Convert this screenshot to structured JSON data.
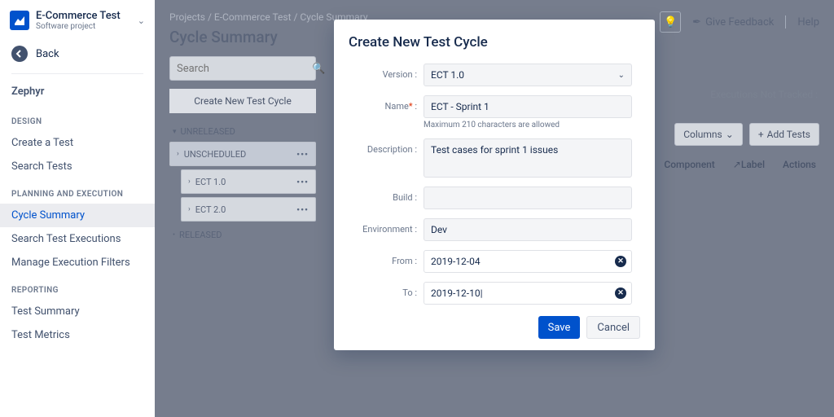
{
  "sidebar": {
    "project": {
      "name": "E-Commerce Test",
      "subtitle": "Software project"
    },
    "back": "Back",
    "app": "Zephyr",
    "sections": [
      {
        "label": "DESIGN",
        "items": [
          "Create a Test",
          "Search Tests"
        ]
      },
      {
        "label": "PLANNING AND EXECUTION",
        "items": [
          "Cycle Summary",
          "Search Test Executions",
          "Manage Execution Filters"
        ],
        "active": 0
      },
      {
        "label": "REPORTING",
        "items": [
          "Test Summary",
          "Test Metrics"
        ]
      }
    ]
  },
  "breadcrumb": [
    "Projects",
    "E-Commerce Test",
    "Cycle Summary"
  ],
  "page_title": "Cycle Summary",
  "header_actions": {
    "feedback": "Give Feedback",
    "help": "Help"
  },
  "search_placeholder": "Search",
  "create_cycle_btn": "Create New Test Cycle",
  "tree": {
    "unreleased": "UNRELEASED",
    "unscheduled": "UNSCHEDULED",
    "ect1": "ECT 1.0",
    "ect2": "ECT 2.0",
    "released": "RELEASED"
  },
  "tracking_label": "Executions Not Tracked :",
  "columns_btn": "Columns",
  "add_tests_btn": "Add Tests",
  "table_headers": [
    "Component",
    "Label",
    "Actions"
  ],
  "modal": {
    "title": "Create New Test Cycle",
    "labels": {
      "version": "Version :",
      "name": "Name",
      "name_colon": " :",
      "description": "Description :",
      "build": "Build :",
      "environment": "Environment :",
      "from": "From :",
      "to": "To :"
    },
    "values": {
      "version": "ECT 1.0",
      "name": "ECT - Sprint 1",
      "description": "Test cases for sprint 1 issues",
      "build": "",
      "environment": "Dev",
      "from": "2019-12-04",
      "to": "2019-12-10|"
    },
    "hint": "Maximum 210 characters are allowed",
    "save": "Save",
    "cancel": "Cancel"
  }
}
